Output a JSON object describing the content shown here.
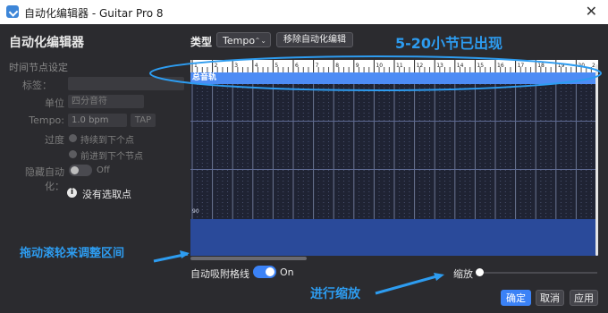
{
  "window": {
    "title": "自动化编辑器 - Guitar Pro 8"
  },
  "left_panel": {
    "heading": "自动化编辑器",
    "section": "时间节点设定",
    "label_field": {
      "label": "标签："
    },
    "unit": {
      "label": "单位",
      "value": "四分音符"
    },
    "tempo": {
      "label": "Tempo:",
      "value": "1.0 bpm",
      "tap": "TAP"
    },
    "transition": {
      "label": "过度",
      "option1": "持续到下个点",
      "option2": "前进到下个节点"
    },
    "hide_automation": {
      "label": "隐藏自动化：",
      "state": "Off"
    },
    "no_selection": "没有选取点"
  },
  "toolbar": {
    "type_label": "类型",
    "type_value": "Tempo",
    "remove_label": "移除自动化编辑"
  },
  "annotations": {
    "top": "5-20小节已出现",
    "scroll": "拖动滚轮来调整区间",
    "zoom": "进行缩放"
  },
  "editor": {
    "track_name": "总音轨",
    "value_label": "90",
    "ruler_numbers": [
      "1",
      "2",
      "3",
      "4",
      "5",
      "6",
      "7",
      "8",
      "9",
      "10",
      "11",
      "12",
      "13",
      "14",
      "15",
      "16",
      "17",
      "18",
      "19",
      "20"
    ],
    "right_edge_number": "2"
  },
  "bottom": {
    "snap_label": "自动吸附格线",
    "snap_state": "On",
    "zoom_label": "缩放"
  },
  "buttons": {
    "ok": "确定",
    "cancel": "取消",
    "apply": "应用"
  },
  "colors": {
    "accent": "#3b82f6",
    "annotation": "#2d9cf0",
    "track": "#4d8cf5"
  }
}
